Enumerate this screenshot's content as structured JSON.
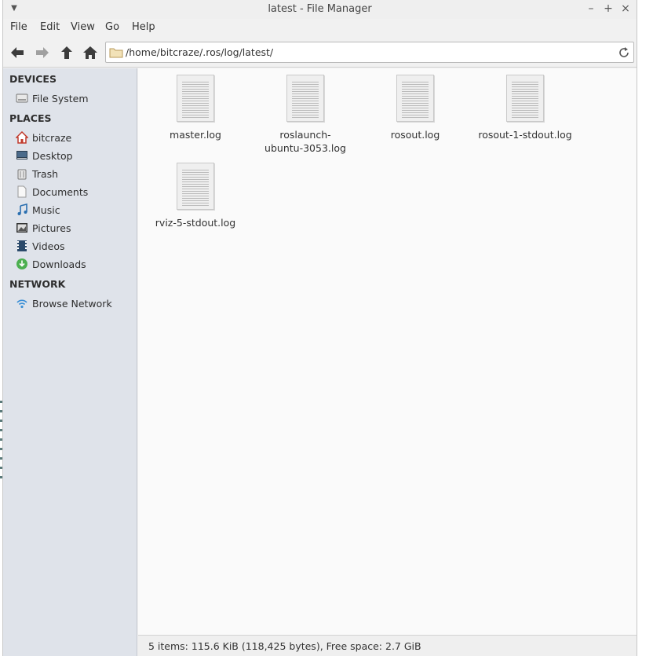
{
  "window": {
    "title": "latest - File Manager"
  },
  "menubar": {
    "items": [
      "File",
      "Edit",
      "View",
      "Go",
      "Help"
    ]
  },
  "toolbar": {
    "path": "/home/bitcraze/.ros/log/latest/"
  },
  "sidebar": {
    "devices_header": "DEVICES",
    "devices": [
      {
        "label": "File System",
        "icon": "drive-icon"
      }
    ],
    "places_header": "PLACES",
    "places": [
      {
        "label": "bitcraze",
        "icon": "home-icon"
      },
      {
        "label": "Desktop",
        "icon": "desktop-icon"
      },
      {
        "label": "Trash",
        "icon": "trash-icon"
      },
      {
        "label": "Documents",
        "icon": "documents-icon"
      },
      {
        "label": "Music",
        "icon": "music-icon"
      },
      {
        "label": "Pictures",
        "icon": "pictures-icon"
      },
      {
        "label": "Videos",
        "icon": "videos-icon"
      },
      {
        "label": "Downloads",
        "icon": "downloads-icon"
      }
    ],
    "network_header": "NETWORK",
    "network": [
      {
        "label": "Browse Network",
        "icon": "network-icon"
      }
    ]
  },
  "files": [
    {
      "line1": "master.log",
      "line2": ""
    },
    {
      "line1": "roslaunch-",
      "line2": "ubuntu-3053.log"
    },
    {
      "line1": "rosout.log",
      "line2": ""
    },
    {
      "line1": "rosout-1-stdout.log",
      "line2": ""
    },
    {
      "line1": "rviz-5-stdout.log",
      "line2": ""
    }
  ],
  "status": {
    "text": "5 items: 115.6 KiB (118,425 bytes), Free space: 2.7 GiB"
  },
  "colors": {
    "sidebar_bg": "#dfe3ea",
    "content_bg": "#fafafa",
    "home_icon": "#c0392b",
    "downloads_icon": "#4caf50",
    "network_icon": "#3a8fd6"
  }
}
